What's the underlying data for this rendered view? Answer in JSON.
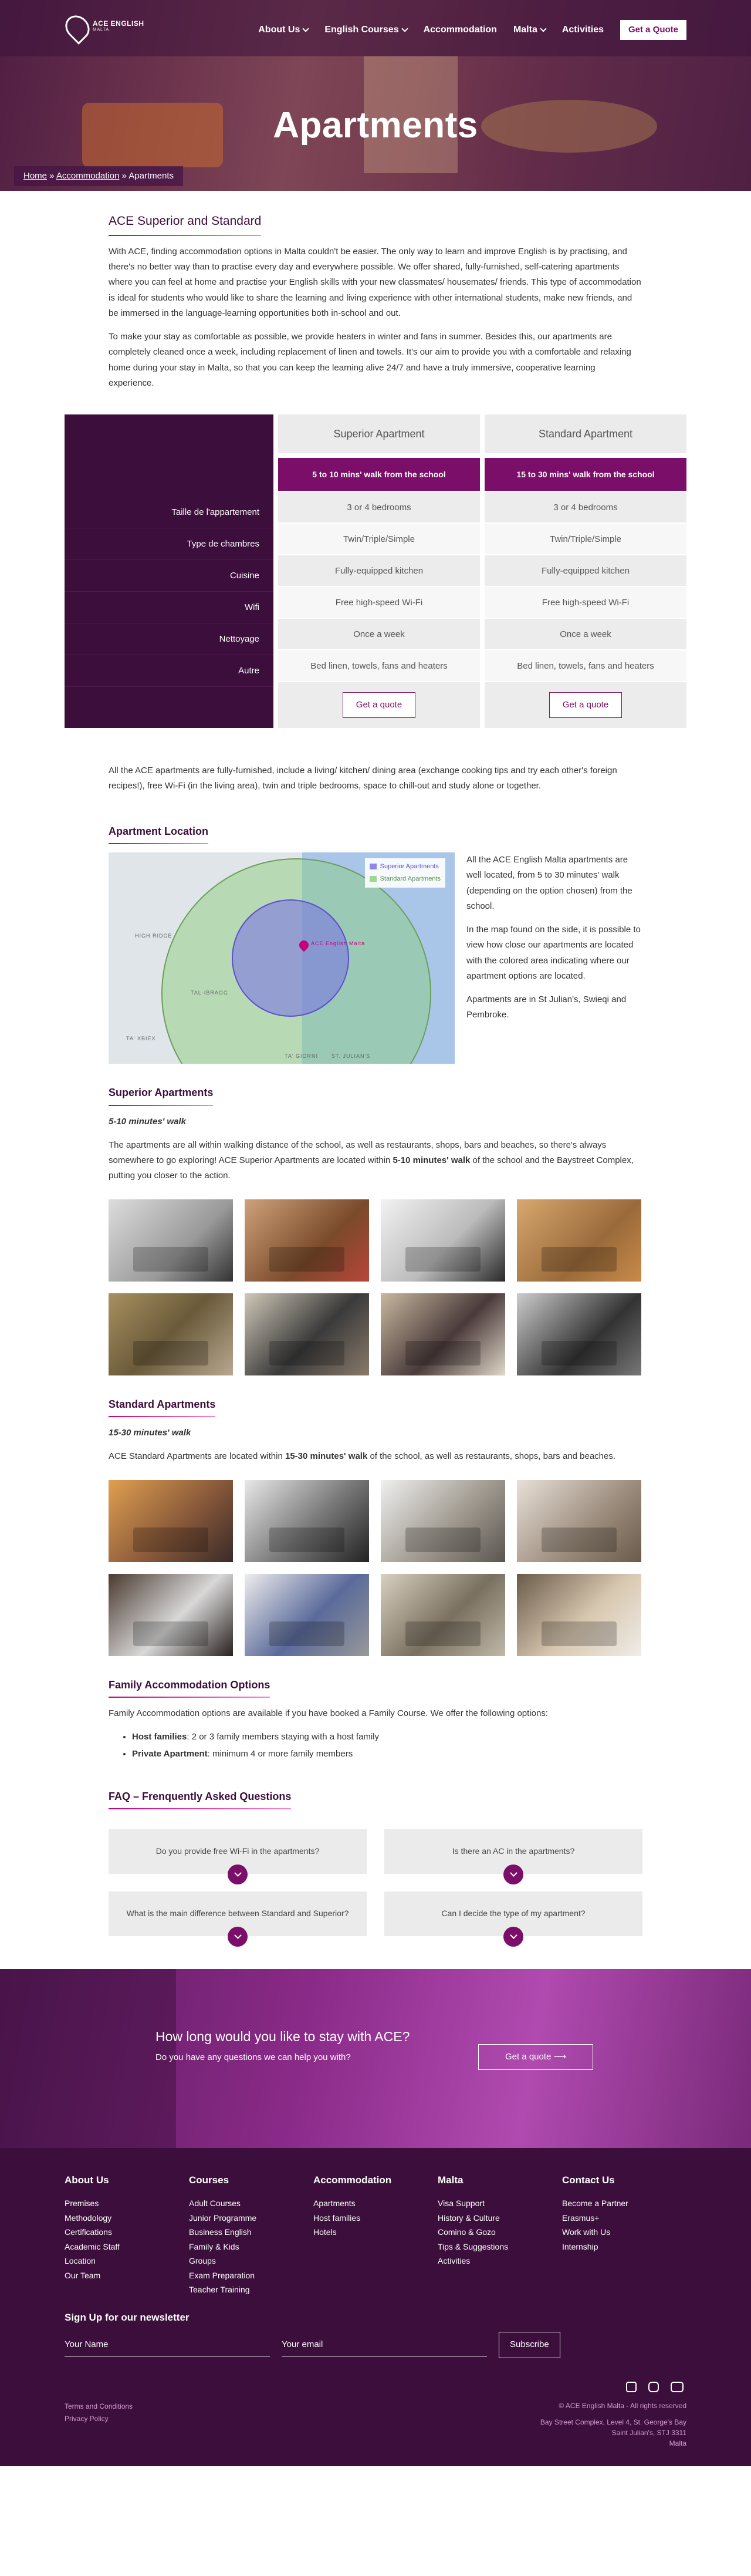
{
  "nav": {
    "logo_text": "ACE ENGLISH",
    "logo_sub": "MALTA",
    "items": [
      "About Us",
      "English Courses",
      "Accommodation",
      "Malta",
      "Activities"
    ],
    "quote": "Get a Quote"
  },
  "hero": {
    "title": "Apartments",
    "crumb_home": "Home",
    "crumb_sep1": " » ",
    "crumb_acc": "Accommodation",
    "crumb_sep2": " » ",
    "crumb_current": "Apartments"
  },
  "intro": {
    "heading": "ACE Superior and Standard",
    "p1": "With ACE, finding accommodation options in Malta couldn't be easier. The only way to learn and improve English is by practising, and there's no better way than to practise every day and everywhere possible. We offer shared, fully-furnished, self-catering apartments where you can feel at home and practise your English skills with your new classmates/ housemates/ friends. This type of accommodation is ideal for students who would like to share the learning and living experience with other international students, make new friends, and be immersed in the language-learning opportunities both in-school and out.",
    "p2": "To make your stay as comfortable as possible, we provide heaters in winter and fans in summer. Besides this, our apartments are completely cleaned once a week, including replacement of linen and towels. It's our aim to provide you with a comfortable and relaxing home during your stay in Malta, so that you can keep the learning alive 24/7 and have a truly immersive, cooperative learning experience."
  },
  "compare": {
    "labels": [
      "Taille de l'appartement",
      "Type de chambres",
      "Cuisine",
      "Wifi",
      "Nettoyage",
      "Autre"
    ],
    "superior": {
      "name": "Superior Apartment",
      "walk": "5 to 10 mins' walk from the school",
      "cells": [
        "3 or 4 bedrooms",
        "Twin/Triple/Simple",
        "Fully-equipped kitchen",
        "Free high-speed Wi-Fi",
        "Once a week",
        "Bed linen, towels, fans and heaters"
      ],
      "btn": "Get a quote"
    },
    "standard": {
      "name": "Standard Apartment",
      "walk": "15 to 30 mins' walk from the school",
      "cells": [
        "3 or 4 bedrooms",
        "Twin/Triple/Simple",
        "Fully-equipped kitchen",
        "Free high-speed Wi-Fi",
        "Once a week",
        "Bed linen, towels, fans and heaters"
      ],
      "btn": "Get a quote"
    }
  },
  "furnished": "All the ACE apartments are fully-furnished, include a living/ kitchen/ dining area (exchange cooking tips and try each other's foreign recipes!), free Wi-Fi (in the living area), twin and triple bedrooms, space to chill-out and study alone or together.",
  "location": {
    "heading": "Apartment Location",
    "p1": "All the ACE English Malta apartments are well located, from 5 to 30 minutes' walk (depending on the option chosen) from the school.",
    "p2": "In the map found on the side, it is possible to view how close our apartments are located with the colored area indicating where our apartment options are located.",
    "p3": "Apartments are in St Julian's, Swieqi and Pembroke.",
    "legend_superior": "Superior Apartments",
    "legend_standard": "Standard Apartments",
    "pin_label": "ACE English Malta",
    "place1": "HIGH RIDGE",
    "place2": "TAL-IBRAGG",
    "place3": "TA' XBIEX",
    "place4": "TA' GIORNI",
    "place5": "ST. JULIAN'S"
  },
  "superior_section": {
    "heading": "Superior Apartments",
    "sub": "5-10 minutes' walk",
    "p_before": "The apartments are all within walking distance of the school, as well as restaurants, shops, bars and beaches, so there's always somewhere to go exploring! ACE Superior Apartments are located within ",
    "p_bold": "5-10 minutes' walk",
    "p_after": " of the school and the Baystreet Complex, putting you closer to the action."
  },
  "standard_section": {
    "heading": "Standard Apartments",
    "sub": "15-30 minutes' walk",
    "p_before": "ACE Standard Apartments are located within ",
    "p_bold": "15-30 minutes' walk",
    "p_after": " of the school, as well as restaurants, shops, bars and beaches."
  },
  "family": {
    "heading": "Family Accommodation Options",
    "p": "Family Accommodation options are available if you have booked a Family Course. We offer the following options:",
    "o1_bold": "Host families",
    "o1_rest": ": 2 or 3 family members staying with a host family",
    "o2_bold": "Private Apartment",
    "o2_rest": ": minimum 4 or more family members"
  },
  "faq": {
    "heading": "FAQ – Frenquently Asked Questions",
    "q": [
      "Do you provide free Wi-Fi in the apartments?",
      "Is there an AC in the apartments?",
      "What is the main difference between Standard and Superior?",
      "Can I decide the type of my apartment?"
    ]
  },
  "cta": {
    "title": "How long would you like to stay with ACE?",
    "sub": "Do you have any questions we can help you with?",
    "btn": "Get a quote ⟶"
  },
  "footer": {
    "cols": [
      {
        "title": "About Us",
        "items": [
          "Premises",
          "Methodology",
          "Certifications",
          "Academic Staff",
          "Location",
          "Our Team"
        ]
      },
      {
        "title": "Courses",
        "items": [
          "Adult Courses",
          "Junior Programme",
          "Business English",
          "Family & Kids",
          "Groups",
          "Exam Preparation",
          "Teacher Training"
        ]
      },
      {
        "title": "Accommodation",
        "items": [
          "Apartments",
          "Host families",
          "Hotels"
        ]
      },
      {
        "title": "Malta",
        "items": [
          "Visa Support",
          "History & Culture",
          "Comino & Gozo",
          "Tips & Suggestions",
          "Activities"
        ]
      },
      {
        "title": "Contact Us",
        "items": [
          "Become a Partner",
          "Erasmus+",
          "Work with Us",
          "Internship"
        ]
      }
    ],
    "newsletter": "Sign Up for our newsletter",
    "name_ph": "Your Name",
    "email_ph": "Your email",
    "subscribe": "Subscribe",
    "terms": "Terms and Conditions",
    "privacy": "Privacy Policy",
    "copyright": "© ACE English Malta - All rights reserved",
    "address1": "Bay Street Complex, Level 4, St. George's Bay",
    "address2": "Saint Julian's, STJ 3311",
    "address3": "Malta"
  },
  "colors": {
    "brand": "#7a0e68",
    "dark": "#3c0e3c",
    "accent": "#c7007a"
  }
}
